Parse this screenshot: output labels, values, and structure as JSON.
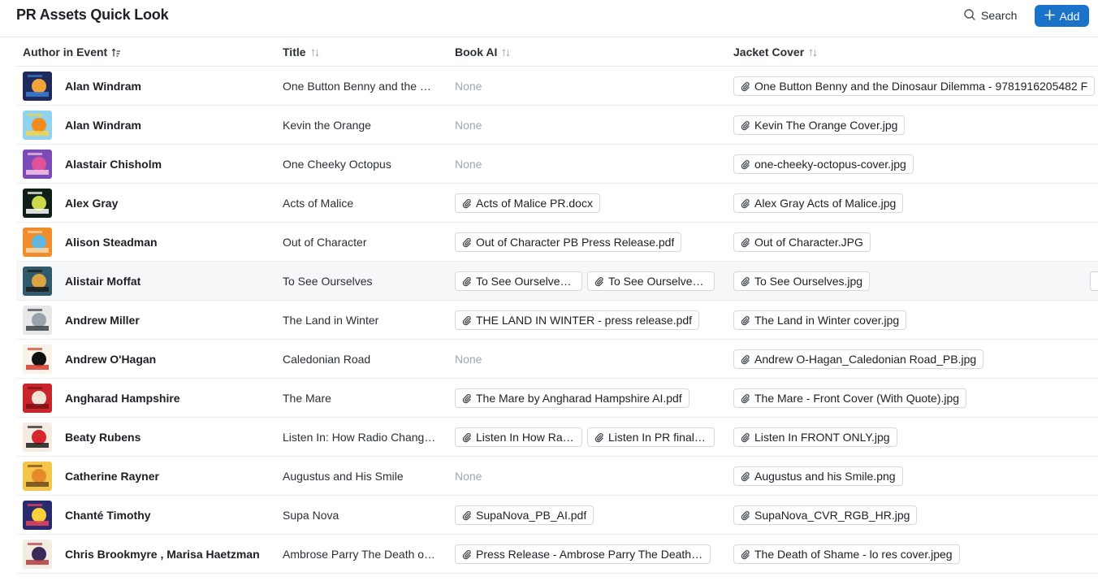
{
  "header": {
    "title": "PR Assets Quick Look",
    "search_label": "Search",
    "add_label": "Add"
  },
  "columns": {
    "author": "Author in Event",
    "title": "Title",
    "book_ai": "Book AI",
    "jacket": "Jacket Cover"
  },
  "none_label": "None",
  "rows": [
    {
      "author": "Alan Windram",
      "title": "One Button Benny and the Dinosaur Dilemma",
      "book_ai": [],
      "jacket": [
        "One Button Benny and the Dinosaur Dilemma - 9781916205482 F"
      ],
      "cover_colors": [
        "#1e2a5c",
        "#f2a33a",
        "#3a7fd0"
      ]
    },
    {
      "author": "Alan Windram",
      "title": "Kevin the Orange",
      "book_ai": [],
      "jacket": [
        "Kevin The Orange Cover.jpg"
      ],
      "cover_colors": [
        "#8fd3ef",
        "#f08c1e",
        "#f5d24a"
      ]
    },
    {
      "author": "Alastair Chisholm",
      "title": "One Cheeky Octopus",
      "book_ai": [],
      "jacket": [
        "one-cheeky-octopus-cover.jpg"
      ],
      "cover_colors": [
        "#7c4bb5",
        "#e0529a",
        "#f3c8e6"
      ]
    },
    {
      "author": "Alex Gray",
      "title": "Acts of Malice",
      "book_ai": [
        "Acts of Malice PR.docx"
      ],
      "jacket": [
        "Alex Gray Acts of Malice.jpg"
      ],
      "cover_colors": [
        "#0f1f17",
        "#c9d94a",
        "#ffffff"
      ]
    },
    {
      "author": "Alison Steadman",
      "title": "Out of Character",
      "book_ai": [
        "Out of Character PB Press Release.pdf"
      ],
      "jacket": [
        "Out of Character.JPG"
      ],
      "cover_colors": [
        "#f28c2a",
        "#5fb6e0",
        "#f5d9b0"
      ]
    },
    {
      "author": "Alistair Moffat",
      "title": "To See Ourselves",
      "book_ai": [
        "To See Ourselves PR.pdf",
        "To See Ourselves AI.pdf"
      ],
      "jacket": [
        "To See Ourselves.jpg"
      ],
      "cover_colors": [
        "#2e5a6b",
        "#d9a441",
        "#1b1b1b"
      ],
      "highlight": true
    },
    {
      "author": "Andrew Miller",
      "title": "The Land in Winter",
      "book_ai": [
        "THE LAND IN WINTER - press release.pdf"
      ],
      "jacket": [
        "The Land in Winter cover.jpg"
      ],
      "cover_colors": [
        "#e8e8e8",
        "#9aa3ab",
        "#3c4247"
      ]
    },
    {
      "author": "Andrew O'Hagan",
      "title": "Caledonian Road",
      "book_ai": [],
      "jacket": [
        "Andrew O-Hagan_Caledonian Road_PB.jpg"
      ],
      "cover_colors": [
        "#f7f3e8",
        "#111111",
        "#d83a2c"
      ]
    },
    {
      "author": "Angharad Hampshire",
      "title": "The Mare",
      "book_ai": [
        "The Mare by Angharad Hampshire AI.pdf"
      ],
      "jacket": [
        "The Mare - Front Cover (With Quote).jpg"
      ],
      "cover_colors": [
        "#c8262b",
        "#f1e4d6",
        "#7a1014"
      ]
    },
    {
      "author": "Beaty Rubens",
      "title": "Listen In: How Radio Changed the World",
      "book_ai": [
        "Listen In How Radio AI.pdf",
        "Listen In PR final.pdf"
      ],
      "jacket": [
        "Listen In FRONT ONLY.jpg"
      ],
      "cover_colors": [
        "#f4ece0",
        "#d7262d",
        "#1d1d1d"
      ]
    },
    {
      "author": "Catherine Rayner",
      "title": "Augustus and His Smile",
      "book_ai": [],
      "jacket": [
        "Augustus and his Smile.png"
      ],
      "cover_colors": [
        "#f3c64b",
        "#e58a2a",
        "#6b4a1d"
      ]
    },
    {
      "author": "Chanté Timothy",
      "title": "Supa Nova",
      "book_ai": [
        "SupaNova_PB_AI.pdf"
      ],
      "jacket": [
        "SupaNova_CVR_RGB_HR.jpg"
      ],
      "cover_colors": [
        "#2a2a6e",
        "#f7d23a",
        "#e8455e"
      ]
    },
    {
      "author": "Chris Brookmyre , Marisa Haetzman",
      "title": "Ambrose Parry The Death of Shame",
      "book_ai": [
        "Press Release - Ambrose Parry The Death of Shame.pdf"
      ],
      "jacket": [
        "The Death of Shame - lo res cover.jpeg"
      ],
      "cover_colors": [
        "#f2ede3",
        "#3b2a5a",
        "#b33b3b"
      ]
    }
  ]
}
